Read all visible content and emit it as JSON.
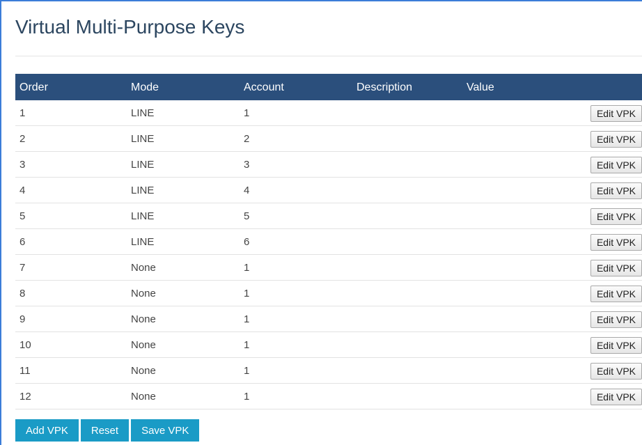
{
  "page": {
    "title": "Virtual Multi-Purpose Keys"
  },
  "table": {
    "headers": {
      "order": "Order",
      "mode": "Mode",
      "account": "Account",
      "description": "Description",
      "value": "Value"
    },
    "rows": [
      {
        "order": "1",
        "mode": "LINE",
        "account": "1",
        "description": "",
        "value": "",
        "edit_label": "Edit VPK"
      },
      {
        "order": "2",
        "mode": "LINE",
        "account": "2",
        "description": "",
        "value": "",
        "edit_label": "Edit VPK"
      },
      {
        "order": "3",
        "mode": "LINE",
        "account": "3",
        "description": "",
        "value": "",
        "edit_label": "Edit VPK"
      },
      {
        "order": "4",
        "mode": "LINE",
        "account": "4",
        "description": "",
        "value": "",
        "edit_label": "Edit VPK"
      },
      {
        "order": "5",
        "mode": "LINE",
        "account": "5",
        "description": "",
        "value": "",
        "edit_label": "Edit VPK"
      },
      {
        "order": "6",
        "mode": "LINE",
        "account": "6",
        "description": "",
        "value": "",
        "edit_label": "Edit VPK"
      },
      {
        "order": "7",
        "mode": "None",
        "account": "1",
        "description": "",
        "value": "",
        "edit_label": "Edit VPK"
      },
      {
        "order": "8",
        "mode": "None",
        "account": "1",
        "description": "",
        "value": "",
        "edit_label": "Edit VPK"
      },
      {
        "order": "9",
        "mode": "None",
        "account": "1",
        "description": "",
        "value": "",
        "edit_label": "Edit VPK"
      },
      {
        "order": "10",
        "mode": "None",
        "account": "1",
        "description": "",
        "value": "",
        "edit_label": "Edit VPK"
      },
      {
        "order": "11",
        "mode": "None",
        "account": "1",
        "description": "",
        "value": "",
        "edit_label": "Edit VPK"
      },
      {
        "order": "12",
        "mode": "None",
        "account": "1",
        "description": "",
        "value": "",
        "edit_label": "Edit VPK"
      }
    ]
  },
  "actions": {
    "add_label": "Add VPK",
    "reset_label": "Reset",
    "save_label": "Save VPK"
  },
  "colors": {
    "header_bg": "#2b4f7c",
    "action_button_bg": "#1a9bc6",
    "title_text": "#2c4660"
  }
}
